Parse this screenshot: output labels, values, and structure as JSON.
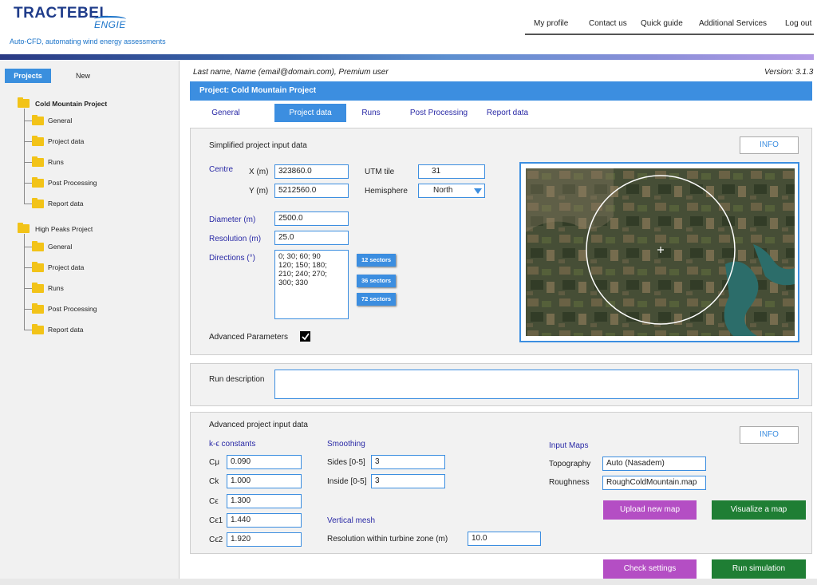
{
  "brand": {
    "logo": "TRACTEBEL",
    "logo_sub": "ENGIE",
    "tagline": "Auto-CFD, automating wind energy assessments",
    "accent_color": "#3c8ee0"
  },
  "topnav": [
    "My profile",
    "Contact us",
    "Quick guide",
    "Additional Services",
    "Log out"
  ],
  "sidebar": {
    "tab_projects": "Projects",
    "tab_new": "New",
    "projects": [
      {
        "name": "Cold Mountain Project",
        "children": [
          "General",
          "Project data",
          "Runs",
          "Post Processing",
          "Report data"
        ]
      },
      {
        "name": "High Peaks Project",
        "children": [
          "General",
          "Project data",
          "Runs",
          "Post Processing",
          "Report data"
        ]
      }
    ]
  },
  "user_line": "Last name, Name (email@domain.com), Premium user",
  "version": "Version: 3.1.3",
  "project_title": "Project: Cold Mountain Project",
  "tabs": [
    "General",
    "Project data",
    "Runs",
    "Post Processing",
    "Report data"
  ],
  "active_tab": "Project data",
  "simplified": {
    "title": "Simplified project input data",
    "info": "INFO",
    "centre_label": "Centre",
    "x_label": "X (m)",
    "x_value": "323860.0",
    "y_label": "Y (m)",
    "y_value": "5212560.0",
    "utm_label": "UTM tile",
    "utm_value": "31",
    "hemisphere_label": "Hemisphere",
    "hemisphere_value": "North",
    "diameter_label": "Diameter (m)",
    "diameter_value": "2500.0",
    "resolution_label": "Resolution (m)",
    "resolution_value": "25.0",
    "directions_label": "Directions (°)",
    "directions_value": "0; 30; 60; 90\n120; 150; 180;\n210; 240; 270;\n300; 330",
    "sector_buttons": [
      "12 sectors",
      "36 sectors",
      "72 sectors"
    ],
    "advanced_label": "Advanced Parameters",
    "advanced_checked": true
  },
  "run_description": {
    "label": "Run description",
    "value": ""
  },
  "advanced": {
    "title": "Advanced project input data",
    "info": "INFO",
    "ke_title": "k-ϵ constants",
    "constants": [
      {
        "label": "Cμ",
        "value": "0.090"
      },
      {
        "label": "Ck",
        "value": "1.000"
      },
      {
        "label": "Cϵ",
        "value": "1.300"
      },
      {
        "label": "Cϵ1",
        "value": "1.440"
      },
      {
        "label": "Cϵ2",
        "value": "1.920"
      }
    ],
    "smoothing_title": "Smoothing",
    "sides_label": "Sides [0-5]",
    "sides_value": "3",
    "inside_label": "Inside [0-5]",
    "inside_value": "3",
    "vertical_title": "Vertical mesh",
    "vres_label": "Resolution within turbine zone (m)",
    "vres_value": "10.0",
    "maps_title": "Input Maps",
    "topography_label": "Topography",
    "topography_value": "Auto (Nasadem)",
    "roughness_label": "Roughness",
    "roughness_value": "RoughColdMountain.map",
    "upload_button": "Upload new map",
    "visualize_button": "Visualize a map"
  },
  "actions": {
    "check": "Check settings",
    "run": "Run simulation"
  },
  "colors": {
    "purple_button": "#b44ec4",
    "green_button": "#1f7e34",
    "folder": "#f2c318"
  }
}
